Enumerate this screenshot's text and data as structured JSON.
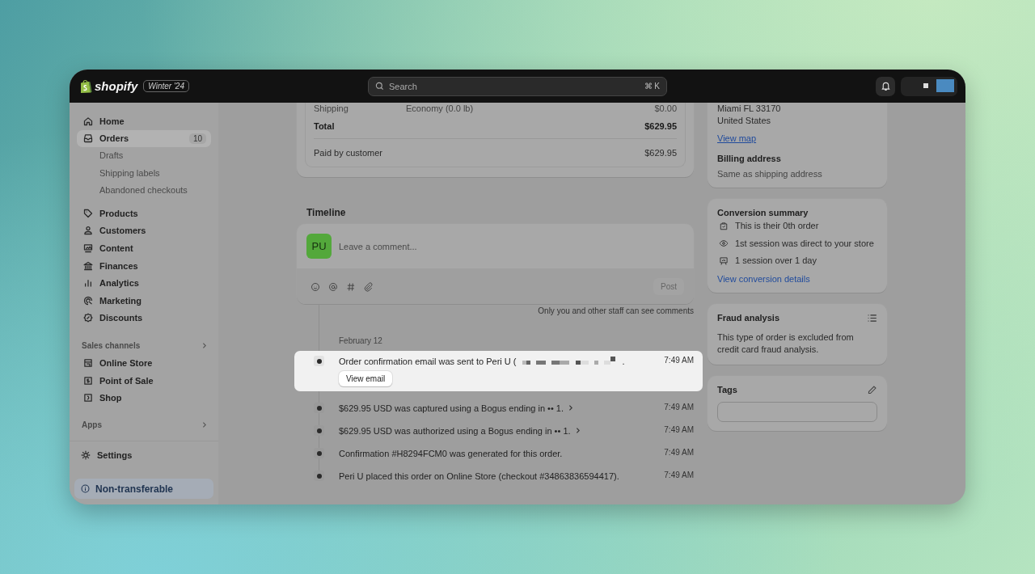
{
  "topbar": {
    "logo": "shopify",
    "badge": "Winter '24",
    "search": {
      "placeholder": "Search",
      "shortcut": "⌘ K"
    }
  },
  "sidebar": {
    "items": [
      {
        "label": "Home",
        "selected": false
      },
      {
        "label": "Orders",
        "selected": true,
        "count": "10",
        "children": [
          {
            "label": "Drafts",
            "selected": false
          },
          {
            "label": "Shipping labels",
            "selected": false
          },
          {
            "label": "Abandoned checkouts",
            "selected": false
          }
        ]
      },
      {
        "label": "Products",
        "selected": false
      },
      {
        "label": "Customers",
        "selected": false
      },
      {
        "label": "Content",
        "selected": false
      },
      {
        "label": "Finances",
        "selected": false
      },
      {
        "label": "Analytics",
        "selected": false
      },
      {
        "label": "Marketing",
        "selected": false
      },
      {
        "label": "Discounts",
        "selected": false
      }
    ],
    "sections": [
      {
        "title": "Sales channels",
        "items": [
          {
            "label": "Online Store",
            "selected": false
          },
          {
            "label": "Point of Sale",
            "selected": false
          },
          {
            "label": "Shop",
            "selected": false
          }
        ]
      },
      {
        "title": "Apps"
      }
    ],
    "settings": {
      "label": "Settings",
      "selected": false
    },
    "notice": "Non-transferable"
  },
  "payment": {
    "rows": [
      {
        "kind": "line",
        "label": "Shipping",
        "detail": "Economy (0.0 lb)",
        "amount": "$0.00"
      },
      {
        "kind": "total",
        "label": "Total",
        "amount": "$629.95"
      },
      {
        "kind": "paid",
        "label": "Paid by customer",
        "amount": "$629.95"
      }
    ]
  },
  "timeline": {
    "title": "Timeline",
    "avatar": "PU",
    "comment": {
      "placeholder": "Leave a comment..."
    },
    "post": {
      "label": "Post",
      "disabled": true
    },
    "note": "Only you and other staff can see comments",
    "date": "February 12",
    "events": [
      {
        "text": "Order confirmation email was sent to Peri U (",
        "redacted": true,
        "end": ".",
        "time": "7:49 AM",
        "selected": true,
        "button": "View email",
        "expandable": false
      },
      {
        "text": "$629.95 USD was captured using a Bogus ending in •• 1.",
        "time": "7:49 AM",
        "selected": false,
        "expandable": true
      },
      {
        "text": "$629.95 USD was authorized using a Bogus ending in •• 1.",
        "time": "7:49 AM",
        "selected": false,
        "expandable": true
      },
      {
        "text": "Confirmation #H8294FCM0 was generated for this order.",
        "time": "7:49 AM",
        "selected": false,
        "expandable": false
      },
      {
        "text": "Peri U placed this order on Online Store (checkout #34863836594417).",
        "time": "7:49 AM",
        "selected": false,
        "expandable": false
      }
    ]
  },
  "address": {
    "lines": [
      "Miami FL 33170",
      "United States"
    ],
    "link": "View map",
    "billing_title": "Billing address",
    "billing_text": "Same as shipping address"
  },
  "conversion": {
    "title": "Conversion summary",
    "items": [
      {
        "text": "This is their 0th order"
      },
      {
        "text": "1st session was direct to your store"
      },
      {
        "text": "1 session over 1 day"
      }
    ],
    "link": "View conversion details"
  },
  "fraud": {
    "title": "Fraud analysis",
    "text": "This type of order is excluded from credit card fraud analysis."
  },
  "tags": {
    "title": "Tags"
  }
}
